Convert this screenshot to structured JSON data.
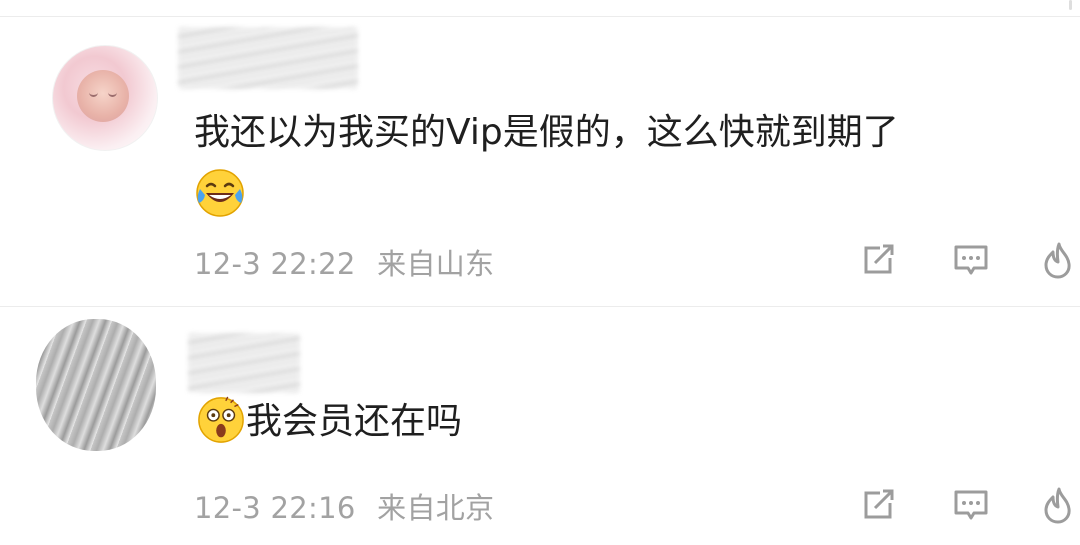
{
  "comments": [
    {
      "avatar_icon": "user-avatar",
      "text": "我还以为我买的Vip是假的，这么快就到期了",
      "emoji_icon": "laughing-crying-face-emoji",
      "time": "12-3 22:22",
      "location": "来自山东",
      "actions": {
        "share_icon": "share-edit-icon",
        "comment_icon": "comment-bubble-icon",
        "like_icon": "fire-like-icon"
      }
    },
    {
      "avatar_icon": "user-avatar",
      "emoji_icon": "astonished-face-emoji",
      "text": "我会员还在吗",
      "time": "12-3 22:16",
      "location": "来自北京",
      "actions": {
        "share_icon": "share-edit-icon",
        "comment_icon": "comment-bubble-icon",
        "like_icon": "fire-like-icon"
      }
    }
  ],
  "colors": {
    "text": "#1f1f1f",
    "meta": "#a2a2a2",
    "icon": "#9c9c9c",
    "divider": "#ececec"
  }
}
